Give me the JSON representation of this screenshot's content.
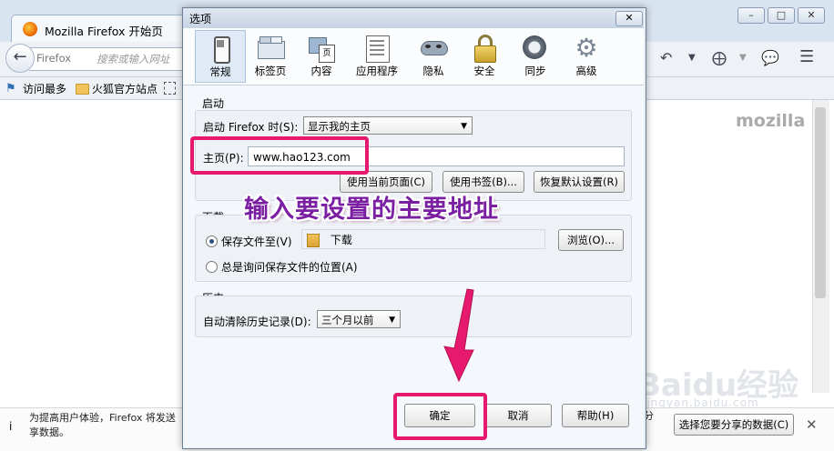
{
  "browser": {
    "tab_title": "Mozilla Firefox 开始页",
    "url_brand": "Firefox",
    "url_placeholder": "搜索或输入网址",
    "bookmarks": [
      "访问最多",
      "火狐官方站点"
    ],
    "logo": "mozilla",
    "window_buttons": [
      "–",
      "□",
      "✕"
    ],
    "notification": {
      "text": "为提高用户体验，Firefox 将发送一些数据至 Mozilla，以便更好地改进 Firefox 享数据。",
      "text_visible_line1": "为提高用户体验，Firefox 将发送",
      "text_visible_line2": "享数据。",
      "fragment": "分",
      "share_button": "选择您要分享的数据(C)",
      "close": "✕"
    }
  },
  "dialog": {
    "title": "选项",
    "close": "✕",
    "panes": [
      {
        "label": "常规",
        "icon": "switch-icon",
        "selected": true
      },
      {
        "label": "标签页",
        "icon": "tabs-icon",
        "selected": false
      },
      {
        "label": "内容",
        "icon": "content-icon",
        "selected": false
      },
      {
        "label": "应用程序",
        "icon": "applications-icon",
        "selected": false
      },
      {
        "label": "隐私",
        "icon": "mask-icon",
        "selected": false
      },
      {
        "label": "安全",
        "icon": "padlock-icon",
        "selected": false
      },
      {
        "label": "同步",
        "icon": "sync-icon",
        "selected": false
      },
      {
        "label": "高级",
        "icon": "gear-icon",
        "selected": false
      }
    ],
    "startup": {
      "group_title": "启动",
      "when_label": "启动 Firefox 时(S):",
      "when_value": "显示我的主页",
      "home_label": "主页(P):",
      "home_value": "www.hao123.com",
      "btn_current": "使用当前页面(C)",
      "btn_bookmark": "使用书签(B)...",
      "btn_restore": "恢复默认设置(R)"
    },
    "downloads": {
      "group_title": "下载",
      "save_label": "保存文件至(V)",
      "save_folder": "下载",
      "browse": "浏览(O)...",
      "ask_label": "总是询问保存文件的位置(A)",
      "save_selected": true
    },
    "history": {
      "group_title": "历史",
      "clear_label": "自动清除历史记录(D):",
      "clear_value": "三个月以前"
    },
    "buttons": {
      "ok": "确定",
      "cancel": "取消",
      "help": "帮助(H)"
    }
  },
  "annotation": {
    "text": "输入要设置的主要地址",
    "color": "#7b1fa2",
    "highlight_color": "#e6196e"
  },
  "watermark": {
    "brand": "Baidu经验",
    "sub": "jingyan.baidu.com"
  }
}
